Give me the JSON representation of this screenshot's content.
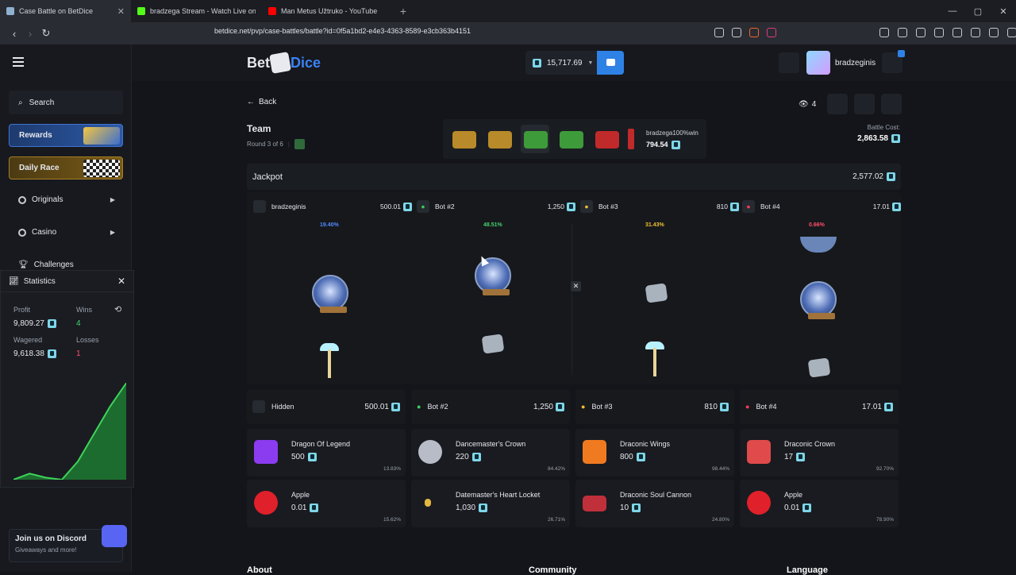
{
  "browser": {
    "tabs": [
      {
        "title": "Case Battle on BetDice",
        "color": "#8fb1d0"
      },
      {
        "title": "bradzega Stream - Watch Live on Kic",
        "color": "#53fc18"
      },
      {
        "title": "Man Metus Užtruko - YouTube",
        "color": "#ff0000"
      }
    ],
    "url": "betdice.net/pvp/case-battles/battle?id=0f5a1bd2-e4e3-4363-8589-e3cb363b4151"
  },
  "sidebar": {
    "search": "Search",
    "rewards": "Rewards",
    "daily_race": "Daily Race",
    "originals": "Originals",
    "casino": "Casino",
    "challenges": "Challenges",
    "discord_title": "Join us on Discord",
    "discord_sub": "Giveaways and more!"
  },
  "stats": {
    "title": "Statistics",
    "profit_label": "Profit",
    "profit": "9,809.27",
    "wins_label": "Wins",
    "wins": "4",
    "wagered_label": "Wagered",
    "wagered": "9,618.38",
    "losses_label": "Losses",
    "losses": "1",
    "profit_curve": [
      0,
      6,
      2,
      0,
      18,
      45,
      72,
      95
    ]
  },
  "topbar": {
    "logo_bet": "Bet",
    "logo_dice": "Dice",
    "balance": "15,717.69",
    "username": "bradzeginis"
  },
  "battle": {
    "back": "Back",
    "viewers": "4",
    "mode": "Team",
    "round": "Round 3 of 6",
    "winner_name": "bradzega100%win",
    "winner_value": "794.54",
    "cost_label": "Battle Cost:",
    "cost": "2,863.58",
    "jackpot_label": "Jackpot",
    "jackpot": "2,577.02",
    "players": [
      {
        "name": "bradzeginis",
        "value": "500.01",
        "pct": "19.40%",
        "pct_color": "#4f8bff",
        "avatar_color": "#6b7280"
      },
      {
        "name": "Bot #2",
        "value": "1,250",
        "pct": "48.51%",
        "pct_color": "#45d16b",
        "avatar_color": "#3ccf5b"
      },
      {
        "name": "Bot #3",
        "value": "810",
        "pct": "31.43%",
        "pct_color": "#f0c030",
        "avatar_color": "#f0c030"
      },
      {
        "name": "Bot #4",
        "value": "17.01",
        "pct": "0.66%",
        "pct_color": "#ff4d6a",
        "avatar_color": "#ff3b5c"
      }
    ],
    "summary": [
      {
        "name": "Hidden",
        "value": "500.01"
      },
      {
        "name": "Bot #2",
        "value": "1,250"
      },
      {
        "name": "Bot #3",
        "value": "810"
      },
      {
        "name": "Bot #4",
        "value": "17.01"
      }
    ],
    "drops_row1": [
      {
        "name": "Dragon Of Legend",
        "price": "500",
        "pct": "13.83%",
        "color": "#8b3cf0"
      },
      {
        "name": "Dancemaster's Crown",
        "price": "220",
        "pct": "84.42%",
        "color": "#b7bcc6"
      },
      {
        "name": "Draconic Wings",
        "price": "800",
        "pct": "98.44%",
        "color": "#f07a20"
      },
      {
        "name": "Draconic Crown",
        "price": "17",
        "pct": "92.70%",
        "color": "#e04a4a"
      }
    ],
    "drops_row2": [
      {
        "name": "Apple",
        "price": "0.01",
        "pct": "15.62%",
        "color": "#e0202a"
      },
      {
        "name": "Datemaster's Heart Locket",
        "price": "1,030",
        "pct": "26.71%",
        "color": "#e5b840"
      },
      {
        "name": "Draconic Soul Cannon",
        "price": "10",
        "pct": "24.80%",
        "color": "#c0303a"
      },
      {
        "name": "Apple",
        "price": "0.01",
        "pct": "78.90%",
        "color": "#e0202a"
      }
    ]
  },
  "footer": {
    "about": "About",
    "community": "Community",
    "language": "Language"
  }
}
